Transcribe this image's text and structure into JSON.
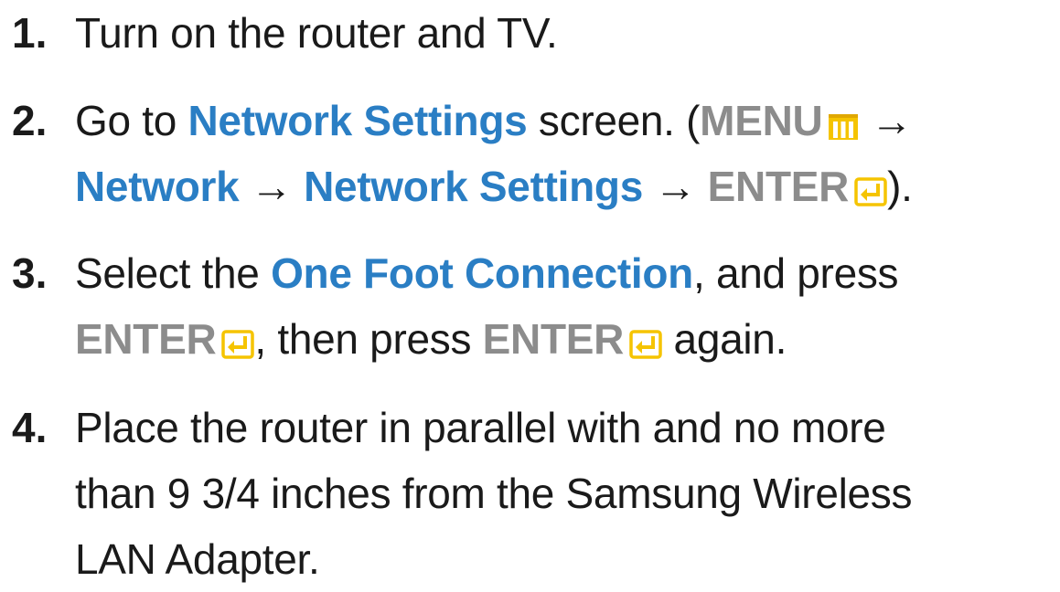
{
  "icons": {
    "menu": "menu-icon",
    "enter": "enter-icon",
    "icon_color": "#f5c400"
  },
  "colors": {
    "link_blue": "#2a7ec4",
    "key_gray": "#8c8c8c",
    "text": "#1a1a1a"
  },
  "steps": [
    {
      "number": "1.",
      "text": "Turn on the router and TV."
    },
    {
      "number": "2.",
      "pre": "Go to ",
      "network_settings": "Network Settings",
      "screen": " screen. (",
      "menu": "MENU",
      "arrow1": " →",
      "network": "Network",
      "arrow2": " → ",
      "network_settings_2": "Network Settings",
      "arrow3": " → ",
      "enter": "ENTER",
      "close": ")."
    },
    {
      "number": "3.",
      "pre": "Select the ",
      "one_foot": "One Foot Connection",
      "post": ", and press",
      "enter1": "ENTER",
      "mid": ", then press ",
      "enter2": "ENTER",
      "end": " again."
    },
    {
      "number": "4.",
      "line1": "Place the router in parallel with and no more",
      "line2": "than 9 3/4 inches from the Samsung Wireless",
      "line3": "LAN Adapter."
    }
  ]
}
